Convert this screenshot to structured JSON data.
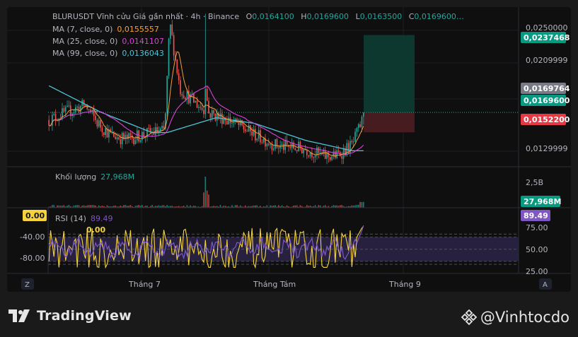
{
  "header": {
    "symbol": "BLURUSDT Vĩnh cửu Giá gần nhất · 4h · Binance",
    "o_label": "O",
    "o_value": "0,0164100",
    "h_label": "H",
    "h_value": "0,0169600",
    "l_label": "L",
    "l_value": "0,0163500",
    "c_label": "C",
    "c_value": "0,0169600…"
  },
  "indicators": [
    {
      "label": "MA (7, close, 0)",
      "value": "0,0155557",
      "color": "#f59d3a"
    },
    {
      "label": "MA (25, close, 0)",
      "value": "0,0141107",
      "color": "#d743d9"
    },
    {
      "label": "MA (99, close, 0)",
      "value": "0,0136043",
      "color": "#4fc3d6"
    }
  ],
  "price_axis": {
    "ticks": [
      "0,0250000",
      "0,0209999",
      "0,0129999"
    ],
    "badges": [
      {
        "text": "0,0237468",
        "color": "#089981"
      },
      {
        "text": "0,0169764",
        "color": "#787b86"
      },
      {
        "text": "0,0169600",
        "color": "#089981"
      },
      {
        "text": "0,0152200",
        "color": "#e53946"
      }
    ]
  },
  "volume": {
    "label": "Khối lượng",
    "value": "27,968M",
    "axis_tick": "2,5B",
    "badge": "27,968M"
  },
  "rsi": {
    "label": "RSI (14)",
    "value": "89.49",
    "badge": "89.49",
    "ticks": [
      "75.00",
      "50.00",
      "25.00"
    ],
    "left_badge": "0.00",
    "left_ticks": [
      "-40.00",
      "-80.00"
    ],
    "overlay_value": "0.00"
  },
  "time_axis": {
    "labels": [
      "Tháng 7",
      "Tháng Tám",
      "Tháng 9"
    ]
  },
  "corner_buttons": {
    "left": "Z",
    "right": "A"
  },
  "footer": {
    "brand": "TradingView",
    "handle": "@Vinhtocdo"
  },
  "colors": {
    "up": "#26a69a",
    "down": "#ef5350",
    "ma7": "#f59d3a",
    "ma25": "#d743d9",
    "ma99": "#4fc3d6",
    "rsi": "#7e57c2",
    "overlay": "#f5d33b"
  },
  "chart_data": {
    "type": "line",
    "price_ylim": [
      0.0122,
      0.0262
    ],
    "n_candles": 190,
    "price_anchors": [
      [
        0,
        0.0163
      ],
      [
        14,
        0.017
      ],
      [
        28,
        0.0176
      ],
      [
        38,
        0.016
      ],
      [
        48,
        0.015
      ],
      [
        60,
        0.0146
      ],
      [
        80,
        0.0152
      ],
      [
        90,
        0.0153
      ],
      [
        94,
        0.0248
      ],
      [
        102,
        0.019
      ],
      [
        122,
        0.017
      ],
      [
        140,
        0.0163
      ],
      [
        160,
        0.015
      ],
      [
        178,
        0.014
      ],
      [
        198,
        0.0138
      ],
      [
        214,
        0.0131
      ],
      [
        224,
        0.0132
      ],
      [
        236,
        0.0141
      ],
      [
        246,
        0.0169
      ]
    ],
    "ma99_anchors": [
      [
        0,
        0.0193
      ],
      [
        40,
        0.017
      ],
      [
        80,
        0.0152
      ],
      [
        92,
        0.0152
      ],
      [
        130,
        0.0165
      ],
      [
        160,
        0.016
      ],
      [
        200,
        0.0145
      ],
      [
        236,
        0.0136
      ],
      [
        246,
        0.0136
      ]
    ],
    "long_position": {
      "entry": 0.01696,
      "target": 0.0237468,
      "stop": 0.01522
    },
    "last_price": 0.01696,
    "rsi_last": 89.49,
    "rsi_levels": [
      70,
      50,
      30
    ]
  }
}
